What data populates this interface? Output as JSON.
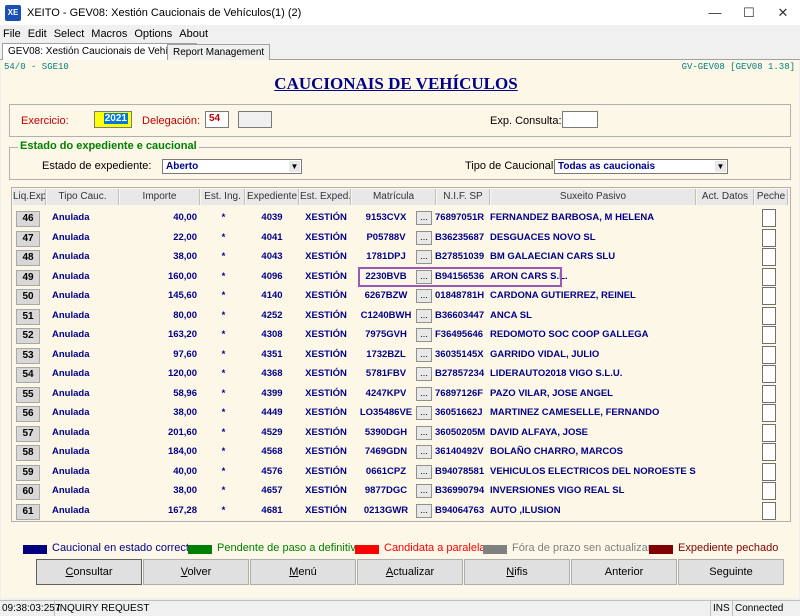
{
  "window": {
    "app_icon_text": "XE",
    "title": "XEITO - GEV08: Xestión Caucionais de Vehículos(1) (2)"
  },
  "menu": [
    "File",
    "Edit",
    "Select",
    "Macros",
    "Options",
    "About"
  ],
  "tabs": [
    {
      "label": "GEV08: Xestión Caucionais de Vehículos",
      "active": true
    },
    {
      "label": "Report Management",
      "active": false
    }
  ],
  "header": {
    "code_left": "54/0 - SGE10",
    "code_right": "GV-GEV08 [GEV08 1.38]",
    "title": "CAUCIONAIS DE VEHÍCULOS"
  },
  "filters": {
    "exercicio_label": "Exercicio:",
    "exercicio_value": "2021",
    "delegacion_label": "Delegación:",
    "delegacion_value": "54",
    "delegacion_extra": "",
    "exp_consulta_label": "Exp. Consulta:",
    "exp_consulta_value": ""
  },
  "estado": {
    "section_title": "Estado do expediente  e caucional",
    "estado_label": "Estado de expediente:",
    "estado_value": "Aberto",
    "tipo_label": "Tipo de Caucional:",
    "tipo_value": "Todas as caucionais"
  },
  "columns": [
    "Liq.Exp.",
    "Tipo Cauc.",
    "Importe",
    "Est. Ing.",
    "Expediente",
    "Est. Exped.",
    "Matrícula",
    "N.I.F. SP",
    "Suxeito Pasivo",
    "Act. Datos",
    "Peche"
  ],
  "rows": [
    {
      "idx": "46",
      "tipo": "Anulada",
      "importe": "40,00",
      "ing": "*",
      "exp": "4039",
      "est": "XESTIÓN",
      "mat": "9153CVX",
      "nif": "76897051R",
      "suxeito": "FERNANDEZ BARBOSA, M HELENA"
    },
    {
      "idx": "47",
      "tipo": "Anulada",
      "importe": "22,00",
      "ing": "*",
      "exp": "4041",
      "est": "XESTIÓN",
      "mat": "P05788V",
      "nif": "B36235687",
      "suxeito": "DESGUACES NOVO SL"
    },
    {
      "idx": "48",
      "tipo": "Anulada",
      "importe": "38,00",
      "ing": "*",
      "exp": "4043",
      "est": "XESTIÓN",
      "mat": "1781DPJ",
      "nif": "B27851039",
      "suxeito": "BM GALAECIAN CARS SLU"
    },
    {
      "idx": "49",
      "tipo": "Anulada",
      "importe": "160,00",
      "ing": "*",
      "exp": "4096",
      "est": "XESTIÓN",
      "mat": "2230BVB",
      "nif": "B94156536",
      "suxeito": "ARON CARS S.L."
    },
    {
      "idx": "50",
      "tipo": "Anulada",
      "importe": "145,60",
      "ing": "*",
      "exp": "4140",
      "est": "XESTIÓN",
      "mat": "6267BZW",
      "nif": "01848781H",
      "suxeito": "CARDONA GUTIERREZ, REINEL"
    },
    {
      "idx": "51",
      "tipo": "Anulada",
      "importe": "80,00",
      "ing": "*",
      "exp": "4252",
      "est": "XESTIÓN",
      "mat": "C1240BWH",
      "nif": "B36603447",
      "suxeito": "ANCA SL"
    },
    {
      "idx": "52",
      "tipo": "Anulada",
      "importe": "163,20",
      "ing": "*",
      "exp": "4308",
      "est": "XESTIÓN",
      "mat": "7975GVH",
      "nif": "F36495646",
      "suxeito": "REDOMOTO SOC COOP GALLEGA"
    },
    {
      "idx": "53",
      "tipo": "Anulada",
      "importe": "97,60",
      "ing": "*",
      "exp": "4351",
      "est": "XESTIÓN",
      "mat": "1732BZL",
      "nif": "36035145X",
      "suxeito": "GARRIDO VIDAL, JULIO"
    },
    {
      "idx": "54",
      "tipo": "Anulada",
      "importe": "120,00",
      "ing": "*",
      "exp": "4368",
      "est": "XESTIÓN",
      "mat": "5781FBV",
      "nif": "B27857234",
      "suxeito": "LIDERAUTO2018 VIGO S.L.U."
    },
    {
      "idx": "55",
      "tipo": "Anulada",
      "importe": "58,96",
      "ing": "*",
      "exp": "4399",
      "est": "XESTIÓN",
      "mat": "4247KPV",
      "nif": "76897126F",
      "suxeito": "PAZO VILAR, JOSE ANGEL"
    },
    {
      "idx": "56",
      "tipo": "Anulada",
      "importe": "38,00",
      "ing": "*",
      "exp": "4449",
      "est": "XESTIÓN",
      "mat": "LO35486VE",
      "nif": "36051662J",
      "suxeito": "MARTINEZ CAMESELLE, FERNANDO"
    },
    {
      "idx": "57",
      "tipo": "Anulada",
      "importe": "201,60",
      "ing": "*",
      "exp": "4529",
      "est": "XESTIÓN",
      "mat": "5390DGH",
      "nif": "36050205M",
      "suxeito": "DAVID ALFAYA, JOSE"
    },
    {
      "idx": "58",
      "tipo": "Anulada",
      "importe": "184,00",
      "ing": "*",
      "exp": "4568",
      "est": "XESTIÓN",
      "mat": "7469GDN",
      "nif": "36140492V",
      "suxeito": "BOLAÑO CHARRO, MARCOS"
    },
    {
      "idx": "59",
      "tipo": "Anulada",
      "importe": "40,00",
      "ing": "*",
      "exp": "4576",
      "est": "XESTIÓN",
      "mat": "0661CPZ",
      "nif": "B94078581",
      "suxeito": "VEHICULOS ELECTRICOS DEL NOROESTE S"
    },
    {
      "idx": "60",
      "tipo": "Anulada",
      "importe": "38,00",
      "ing": "*",
      "exp": "4657",
      "est": "XESTIÓN",
      "mat": "9877DGC",
      "nif": "B36990794",
      "suxeito": "INVERSIONES VIGO REAL SL"
    },
    {
      "idx": "61",
      "tipo": "Anulada",
      "importe": "167,28",
      "ing": "*",
      "exp": "4681",
      "est": "XESTIÓN",
      "mat": "0213GWR",
      "nif": "B94064763",
      "suxeito": "AUTO ,ILUSION"
    }
  ],
  "highlighted_row": "49",
  "dots_label": "...",
  "legend": [
    {
      "label": "Caucional en estado correcto",
      "color": "#000080",
      "text_color": "#000080"
    },
    {
      "label": "Pendente de paso a definitiva",
      "color": "#008000",
      "text_color": "#008000"
    },
    {
      "label": "Candidata a paralela",
      "color": "#ff0000",
      "text_color": "#ff0000"
    },
    {
      "label": "Fóra de prazo sen actualizar",
      "color": "#808080",
      "text_color": "#808080"
    },
    {
      "label": "Expediente pechado",
      "color": "#800000",
      "text_color": "#800000"
    }
  ],
  "buttons": [
    {
      "key": "consultar",
      "pre": "",
      "mn": "C",
      "post": "onsultar"
    },
    {
      "key": "volver",
      "pre": "",
      "mn": "V",
      "post": "olver"
    },
    {
      "key": "menu",
      "pre": "",
      "mn": "M",
      "post": "enú"
    },
    {
      "key": "actualizar",
      "pre": "",
      "mn": "A",
      "post": "ctualizar"
    },
    {
      "key": "nifis",
      "pre": "",
      "mn": "N",
      "post": "ifis"
    },
    {
      "key": "anterior",
      "pre": "Anterior",
      "mn": "",
      "post": ""
    },
    {
      "key": "seguinte",
      "pre": "Seguinte",
      "mn": "",
      "post": ""
    }
  ],
  "status": {
    "time": "09:38:03:257",
    "message": "INQUIRY REQUEST",
    "mode": "INS",
    "connection": "Connected"
  }
}
